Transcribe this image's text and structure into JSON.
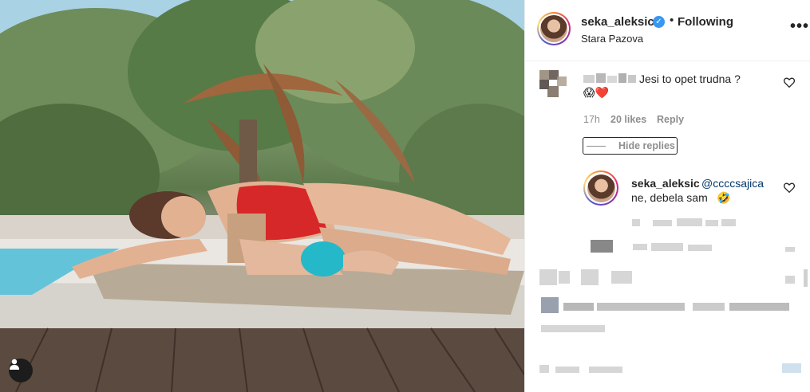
{
  "post_header": {
    "username": "seka_aleksic",
    "separator": "•",
    "follow_status": "Following",
    "location": "Stara Pazova",
    "more_label": "•••"
  },
  "comment_1": {
    "text": "Jesi to opet trudna ?",
    "emoji": "😱❤️",
    "time": "17h",
    "likes": "20 likes",
    "reply_label": "Reply",
    "hide_replies_label": "Hide replies"
  },
  "reply_1": {
    "username": "seka_aleksic",
    "mention": "@ccccsajica",
    "text": "ne, debela sam",
    "emoji": "🤣"
  },
  "colors": {
    "verified": "#3897f0",
    "mention": "#00376b",
    "meta": "#8e8e8e",
    "swimsuit": "#d62828"
  },
  "icons": {
    "verified": "verified-badge-icon",
    "heart": "heart-icon",
    "user_tag": "user-tag-icon",
    "more": "more-options-icon"
  }
}
